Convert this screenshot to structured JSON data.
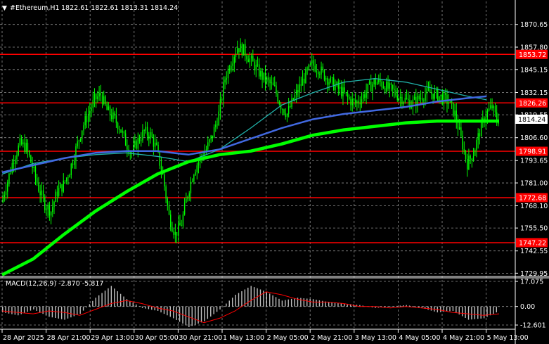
{
  "header": {
    "symbol": "#Ethereum,H1",
    "ohlc": "1822.61 1822.61 1813.31 1814.24"
  },
  "colors": {
    "background": "#000000",
    "grid": "#c0c0c0",
    "candle": "#00ff00",
    "sma_fast": "#20b2aa",
    "sma_mid": "#4169e1",
    "sma_slow": "#00ff00",
    "level_line": "#ff0000",
    "level_label_bg": "#ff0000",
    "price_label_bg": "#ffffff",
    "macd_hist": "#c0c0c0",
    "macd_signal": "#ff0000",
    "text": "#ffffff"
  },
  "chart_data": {
    "type": "candlestick",
    "timeframe": "H1",
    "x_labels": [
      "28 Apr 2025",
      "28 Apr 21:00",
      "29 Apr 13:00",
      "30 Apr 05:00",
      "30 Apr 21:00",
      "1 May 13:00",
      "2 May 05:00",
      "2 May 21:00",
      "3 May 13:00",
      "4 May 05:00",
      "4 May 21:00",
      "5 May 13:00"
    ],
    "y_ticks": [
      "1870.65",
      "1857.80",
      "1845.15",
      "1832.15",
      "1819.55",
      "1806.60",
      "1793.65",
      "1781.00",
      "1768.10",
      "1755.50",
      "1742.55",
      "1729.95"
    ],
    "ylim": [
      1728.5,
      1876.5
    ],
    "last_price": "1814.24",
    "horizontal_levels": [
      {
        "label": "1853.72",
        "value": 1853.72
      },
      {
        "label": "1826.26",
        "value": 1826.26
      },
      {
        "label": "1798.91",
        "value": 1798.91
      },
      {
        "label": "1772.68",
        "value": 1772.68
      },
      {
        "label": "1747.22",
        "value": 1747.22
      }
    ],
    "close_path": [
      [
        0,
        1770
      ],
      [
        4,
        1782
      ],
      [
        8,
        1795
      ],
      [
        12,
        1803
      ],
      [
        16,
        1801
      ],
      [
        20,
        1790
      ],
      [
        24,
        1778
      ],
      [
        28,
        1769
      ],
      [
        32,
        1765
      ],
      [
        36,
        1776
      ],
      [
        40,
        1780
      ],
      [
        44,
        1788
      ],
      [
        48,
        1800
      ],
      [
        52,
        1812
      ],
      [
        56,
        1820
      ],
      [
        60,
        1828
      ],
      [
        64,
        1831
      ],
      [
        68,
        1822
      ],
      [
        72,
        1818
      ],
      [
        76,
        1813
      ],
      [
        80,
        1804
      ],
      [
        84,
        1798
      ],
      [
        88,
        1805
      ],
      [
        92,
        1810
      ],
      [
        96,
        1808
      ],
      [
        100,
        1800
      ],
      [
        104,
        1785
      ],
      [
        108,
        1762
      ],
      [
        112,
        1752
      ],
      [
        116,
        1758
      ],
      [
        120,
        1775
      ],
      [
        124,
        1788
      ],
      [
        128,
        1795
      ],
      [
        132,
        1800
      ],
      [
        136,
        1808
      ],
      [
        140,
        1820
      ],
      [
        144,
        1840
      ],
      [
        148,
        1850
      ],
      [
        152,
        1858
      ],
      [
        156,
        1856
      ],
      [
        160,
        1851
      ],
      [
        164,
        1846
      ],
      [
        168,
        1841
      ],
      [
        172,
        1838
      ],
      [
        176,
        1834
      ],
      [
        180,
        1825
      ],
      [
        184,
        1820
      ],
      [
        188,
        1828
      ],
      [
        192,
        1835
      ],
      [
        196,
        1842
      ],
      [
        200,
        1848
      ],
      [
        204,
        1846
      ],
      [
        208,
        1842
      ],
      [
        212,
        1838
      ],
      [
        216,
        1835
      ],
      [
        220,
        1832
      ],
      [
        224,
        1828
      ],
      [
        228,
        1826
      ],
      [
        232,
        1829
      ],
      [
        236,
        1834
      ],
      [
        240,
        1838
      ],
      [
        244,
        1838
      ],
      [
        248,
        1835
      ],
      [
        252,
        1833
      ],
      [
        256,
        1830
      ],
      [
        260,
        1828
      ],
      [
        264,
        1826
      ],
      [
        268,
        1828
      ],
      [
        272,
        1831
      ],
      [
        276,
        1832
      ],
      [
        280,
        1831
      ],
      [
        284,
        1829
      ],
      [
        288,
        1827
      ],
      [
        292,
        1820
      ],
      [
        296,
        1806
      ],
      [
        300,
        1792
      ],
      [
        304,
        1798
      ],
      [
        308,
        1810
      ],
      [
        312,
        1820
      ],
      [
        316,
        1824
      ],
      [
        320,
        1814.24
      ]
    ],
    "sma_fast": [
      [
        0,
        1786
      ],
      [
        20,
        1792
      ],
      [
        40,
        1795
      ],
      [
        60,
        1797
      ],
      [
        80,
        1798
      ],
      [
        100,
        1796
      ],
      [
        120,
        1793
      ],
      [
        140,
        1800
      ],
      [
        160,
        1812
      ],
      [
        180,
        1825
      ],
      [
        200,
        1832
      ],
      [
        220,
        1838
      ],
      [
        240,
        1840
      ],
      [
        260,
        1838
      ],
      [
        280,
        1834
      ],
      [
        300,
        1830
      ],
      [
        312,
        1828
      ]
    ],
    "sma_mid": [
      [
        0,
        1787
      ],
      [
        20,
        1791
      ],
      [
        40,
        1795
      ],
      [
        60,
        1798
      ],
      [
        80,
        1799
      ],
      [
        100,
        1799
      ],
      [
        120,
        1797
      ],
      [
        140,
        1800
      ],
      [
        160,
        1806
      ],
      [
        180,
        1812
      ],
      [
        200,
        1817
      ],
      [
        220,
        1820
      ],
      [
        240,
        1822
      ],
      [
        260,
        1824
      ],
      [
        280,
        1827
      ],
      [
        300,
        1829
      ],
      [
        312,
        1830
      ]
    ],
    "sma_slow": [
      [
        0,
        1729
      ],
      [
        20,
        1738
      ],
      [
        40,
        1752
      ],
      [
        60,
        1765
      ],
      [
        80,
        1776
      ],
      [
        100,
        1786
      ],
      [
        120,
        1793
      ],
      [
        140,
        1797
      ],
      [
        160,
        1799
      ],
      [
        180,
        1803
      ],
      [
        200,
        1808
      ],
      [
        220,
        1811
      ],
      [
        240,
        1813
      ],
      [
        260,
        1815
      ],
      [
        280,
        1816
      ],
      [
        300,
        1816
      ],
      [
        320,
        1816
      ]
    ],
    "macd": {
      "label": "MACD(12,26,9) -2.870 -5.817",
      "y_ticks": [
        "17.075",
        "0.00",
        "-12.601"
      ],
      "ylim": [
        -14.5,
        19.0
      ],
      "hist": [
        [
          0,
          -4
        ],
        [
          10,
          -6
        ],
        [
          20,
          -2
        ],
        [
          30,
          -7
        ],
        [
          40,
          -9
        ],
        [
          50,
          -5
        ],
        [
          60,
          6
        ],
        [
          70,
          14
        ],
        [
          80,
          5
        ],
        [
          90,
          -1
        ],
        [
          100,
          -3
        ],
        [
          110,
          -8
        ],
        [
          120,
          -14
        ],
        [
          130,
          -10
        ],
        [
          140,
          -2
        ],
        [
          150,
          8
        ],
        [
          160,
          14
        ],
        [
          170,
          10
        ],
        [
          180,
          4
        ],
        [
          190,
          6
        ],
        [
          200,
          5
        ],
        [
          210,
          3
        ],
        [
          220,
          2
        ],
        [
          230,
          1
        ],
        [
          240,
          -1
        ],
        [
          250,
          0
        ],
        [
          260,
          1
        ],
        [
          270,
          -1
        ],
        [
          280,
          -4
        ],
        [
          290,
          -3
        ],
        [
          300,
          -9
        ],
        [
          310,
          -8
        ],
        [
          320,
          -3
        ]
      ],
      "signal": [
        [
          0,
          -3
        ],
        [
          10,
          -4
        ],
        [
          20,
          -5
        ],
        [
          30,
          -3
        ],
        [
          40,
          -4
        ],
        [
          50,
          -6
        ],
        [
          60,
          -2
        ],
        [
          70,
          2
        ],
        [
          80,
          4
        ],
        [
          90,
          2
        ],
        [
          100,
          -1
        ],
        [
          110,
          -3
        ],
        [
          120,
          -7
        ],
        [
          130,
          -11
        ],
        [
          140,
          -8
        ],
        [
          150,
          -3
        ],
        [
          160,
          4
        ],
        [
          170,
          10
        ],
        [
          180,
          8
        ],
        [
          190,
          5
        ],
        [
          200,
          3
        ],
        [
          210,
          3
        ],
        [
          220,
          2
        ],
        [
          230,
          0
        ],
        [
          240,
          0
        ],
        [
          250,
          -1
        ],
        [
          260,
          0
        ],
        [
          270,
          -1
        ],
        [
          280,
          -2
        ],
        [
          290,
          -4
        ],
        [
          300,
          -5
        ],
        [
          310,
          -6
        ],
        [
          320,
          -5
        ]
      ]
    }
  }
}
